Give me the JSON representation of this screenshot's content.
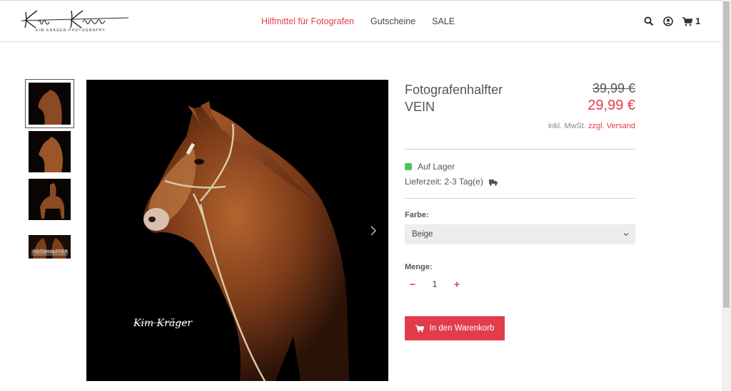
{
  "logo": {
    "script_text": "Kim Kräger",
    "subtitle": "KIM KRÄGER PHOTOGRAPHY"
  },
  "nav": {
    "items": [
      "Hilfmittel für Fotografen",
      "Gutscheine",
      "SALE"
    ],
    "active_color": "#e23c4b"
  },
  "header_icons": {
    "search": "search-icon",
    "account": "user-circle-icon",
    "cart": "cart-icon",
    "cart_count": "1"
  },
  "gallery": {
    "thumb_overlay_text": "FOTOHALFTER",
    "watermark": "Kim Kräger"
  },
  "product": {
    "title_line1": "Fotografenhalfter",
    "title_line2": "VEIN",
    "old_price": "39,99 €",
    "new_price": "29,99 €",
    "tax_text": "inkl. MwSt.",
    "shipping_link": "zzgl. Versand",
    "stock": "Auf Lager",
    "delivery": "Lieferzeit: 2-3 Tag(e)",
    "color_label": "Farbe:",
    "color_value": "Beige",
    "qty_label": "Menge:",
    "qty_value": "1",
    "add_to_cart": "In den Warenkorb"
  },
  "colors": {
    "accent": "#e23c4b",
    "in_stock": "#4cc35e"
  }
}
